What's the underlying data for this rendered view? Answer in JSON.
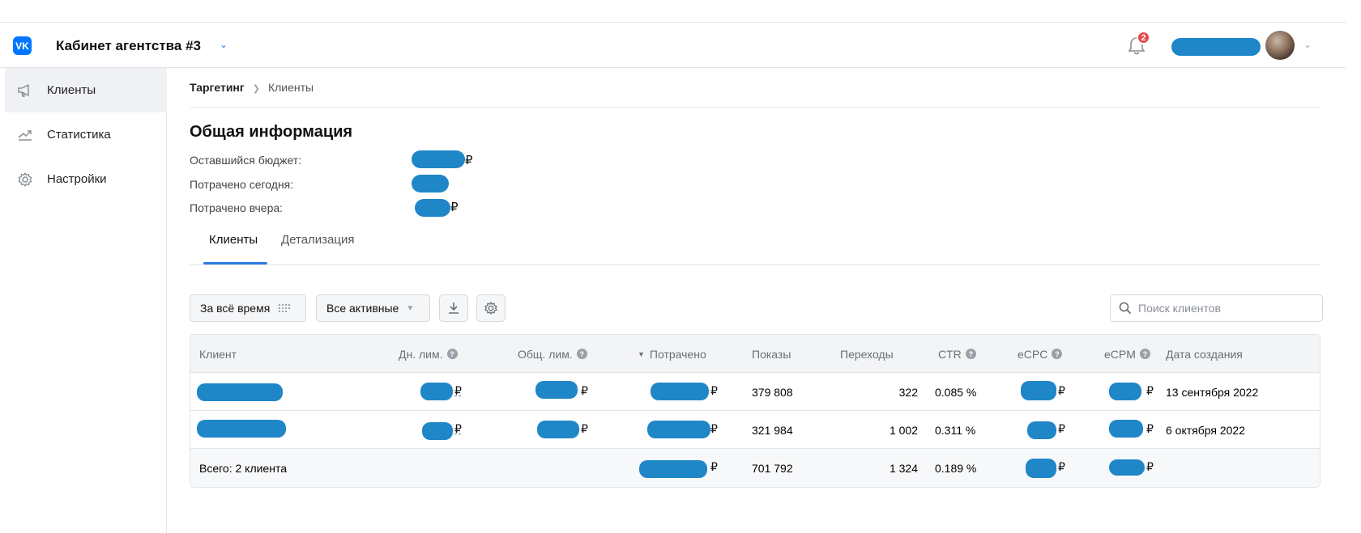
{
  "header": {
    "logo": "VK",
    "cabinet_title": "Кабинет агентства #3",
    "notifications_count": "2"
  },
  "sidebar": {
    "items": [
      {
        "label": "Клиенты",
        "icon": "megaphone-icon",
        "active": true
      },
      {
        "label": "Статистика",
        "icon": "chart-icon",
        "active": false
      },
      {
        "label": "Настройки",
        "icon": "gear-icon",
        "active": false
      }
    ]
  },
  "breadcrumb": {
    "root": "Таргетинг",
    "current": "Клиенты"
  },
  "general": {
    "title": "Общая информация",
    "remaining_label": "Оставшийся бюджет:",
    "today_label": "Потрачено сегодня:",
    "yesterday_label": "Потрачено вчера:",
    "currency": "₽"
  },
  "tabs": {
    "clients": "Клиенты",
    "details": "Детализация"
  },
  "toolbar": {
    "period": "За всё время",
    "filter": "Все активные",
    "search_placeholder": "Поиск клиентов"
  },
  "table": {
    "columns": [
      "Клиент",
      "Дн. лим.",
      "Общ. лим.",
      "Потрачено",
      "Показы",
      "Переходы",
      "CTR",
      "eCPC",
      "eCPM",
      "Дата создания"
    ],
    "rows": [
      {
        "shows": "379 808",
        "clicks": "322",
        "ctr": "0.085 %",
        "created": "13 сентября 2022"
      },
      {
        "shows": "321 984",
        "clicks": "1 002",
        "ctr": "0.311 %",
        "created": "6 октября 2022"
      }
    ],
    "total": {
      "label": "Всего: 2 клиента",
      "shows": "701 792",
      "clicks": "1 324",
      "ctr": "0.189 %"
    }
  },
  "colors": {
    "accent": "#2a7ce0",
    "redaction": "#1f86c8",
    "badge": "#e64646"
  }
}
